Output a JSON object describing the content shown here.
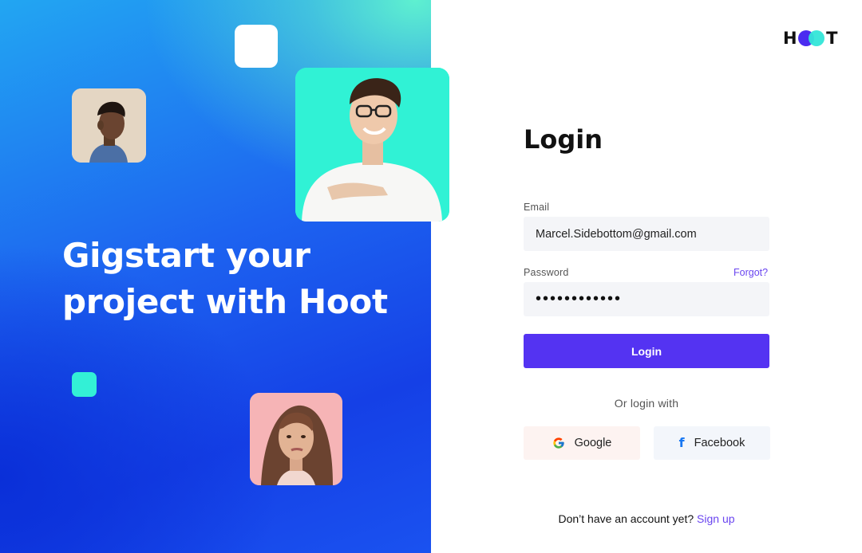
{
  "hero": {
    "title_line1": "Gigstart your",
    "title_line2": "project with Hoot"
  },
  "brand": {
    "logo_left": "H",
    "logo_right": "T",
    "accent_purple": "#5433f2",
    "accent_cyan": "#33e6d8"
  },
  "login": {
    "heading": "Login",
    "email_label": "Email",
    "email_value": "Marcel.Sidebottom@gmail.com",
    "password_label": "Password",
    "password_value": "••••••••••••",
    "forgot_label": "Forgot?",
    "submit_label": "Login",
    "or_text": "Or login with",
    "google_label": "Google",
    "facebook_label": "Facebook",
    "no_account_text": "Don’t have an account yet?",
    "signup_label": "Sign up"
  },
  "icons": {
    "google": "google-icon",
    "facebook": "facebook-icon"
  }
}
